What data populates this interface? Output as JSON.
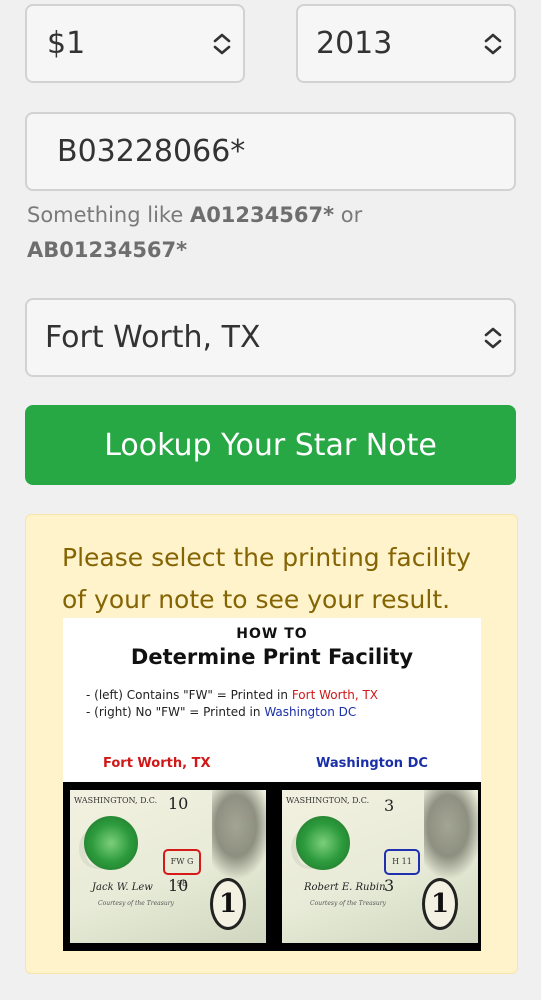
{
  "form": {
    "denomination": {
      "value": "$1",
      "icon": "up-down-chevron-icon"
    },
    "year": {
      "value": "2013",
      "icon": "up-down-chevron-icon"
    },
    "serial": {
      "value": "B03228066*"
    },
    "hint": {
      "prefix": "Something like ",
      "example1": "A01234567*",
      "or": " or",
      "example2": "AB01234567*"
    },
    "facility": {
      "value": "Fort Worth, TX",
      "icon": "up-down-chevron-icon"
    },
    "lookup_button": "Lookup Your Star Note"
  },
  "notice": {
    "message": "Please select the printing facility of your note to see your result.",
    "guide": {
      "how_to": "HOW TO",
      "title": "Determine Print Facility",
      "rule1_prefix": "- (left) Contains \"FW\" = Printed in ",
      "rule1_place": "Fort Worth, TX",
      "rule2_prefix": "- (right) No \"FW\" = Printed in ",
      "rule2_place": "Washington DC",
      "left_label": "Fort Worth, TX",
      "right_label": "Washington DC",
      "left_bill": {
        "header": "WASHINGTON, D.C.",
        "number": "10",
        "marker": "FW G 98",
        "signature": "Jack W. Lew",
        "courtesy": "Courtesy of the Treasury"
      },
      "right_bill": {
        "header": "WASHINGTON, D.C.",
        "number": "3",
        "marker": "H 11",
        "signature": "Robert E. Rubin",
        "courtesy": "Courtesy of the Treasury"
      }
    }
  },
  "colors": {
    "button_green": "#28a745",
    "notice_bg": "#fef3cb",
    "notice_text": "#856404",
    "fw_red": "#d01818",
    "dc_blue": "#1a2fa8"
  }
}
